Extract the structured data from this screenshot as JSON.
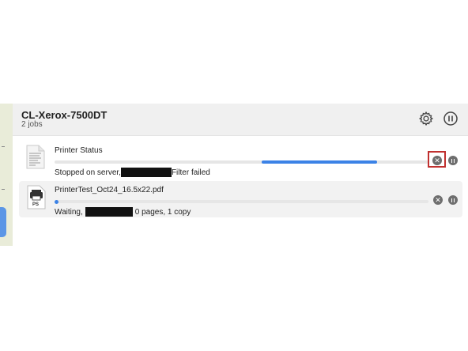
{
  "printer": {
    "name": "CL-Xerox-7500DT",
    "jobs_count": "2 jobs"
  },
  "header_icons": {
    "settings": "gear-icon",
    "pause_queue": "pause-circle-icon"
  },
  "jobs": [
    {
      "title": "Printer Status",
      "status_prefix": "Stopped on server,",
      "status_suffix": "Filter failed",
      "progress_note": "in progress",
      "icon": "document-icon",
      "cancel_highlighted": true
    },
    {
      "title": "PrinterTest_Oct24_16.5x22.pdf",
      "status_prefix": "Waiting,",
      "status_suffix": "0 pages, 1 copy",
      "icon": "postscript-printer-icon",
      "icon_label": "PS",
      "progress": 0
    }
  ],
  "colors": {
    "accent": "#3b82e6",
    "highlight_border": "#c0302f",
    "header_bg": "#f0f0f0"
  }
}
